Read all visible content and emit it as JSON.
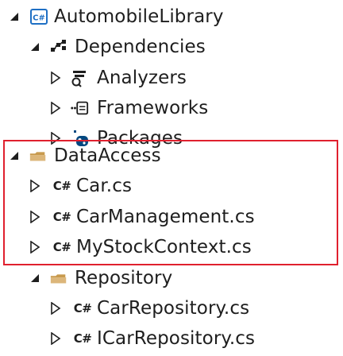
{
  "tree": {
    "nodes": [
      {
        "label": "AutomobileLibrary",
        "expanded": true,
        "icon": "csharp-project-icon"
      },
      {
        "label": "Dependencies",
        "expanded": true,
        "icon": "dependencies-icon"
      },
      {
        "label": "Analyzers",
        "expanded": false,
        "icon": "analyzer-icon"
      },
      {
        "label": "Frameworks",
        "expanded": false,
        "icon": "framework-icon"
      },
      {
        "label": "Packages",
        "expanded": false,
        "icon": "nuget-package-icon"
      },
      {
        "label": "DataAccess",
        "expanded": true,
        "icon": "folder-icon"
      },
      {
        "label": "Car.cs",
        "expanded": false,
        "icon": "csharp-file-icon"
      },
      {
        "label": "CarManagement.cs",
        "expanded": false,
        "icon": "csharp-file-icon"
      },
      {
        "label": "MyStockContext.cs",
        "expanded": false,
        "icon": "csharp-file-icon"
      },
      {
        "label": "Repository",
        "expanded": true,
        "icon": "folder-icon"
      },
      {
        "label": "CarRepository.cs",
        "expanded": false,
        "icon": "csharp-file-icon"
      },
      {
        "label": "ICarRepository.cs",
        "expanded": false,
        "icon": "csharp-file-icon"
      }
    ],
    "cs_glyph": "C#"
  },
  "colors": {
    "text": "#1e1e1e",
    "highlight_border": "#e0202e",
    "project_icon": "#1e6fc4",
    "folder_icon": "#dcb67a",
    "nuget_icon": "#004880"
  }
}
